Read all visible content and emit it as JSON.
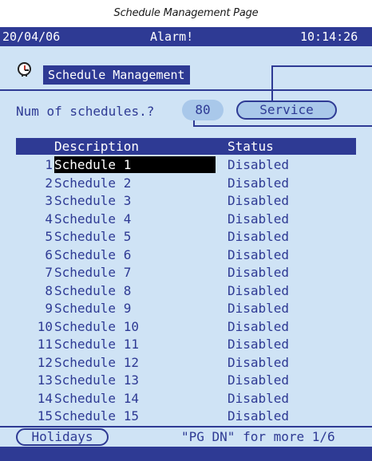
{
  "caption": "Schedule Management Page",
  "status_bar": {
    "date": "20/04/06",
    "alarm": "Alarm!",
    "time": "10:14:26"
  },
  "title": "Schedule Management",
  "num_schedules": {
    "label": "Num of schedules.?",
    "value": "80"
  },
  "service_button": "Service",
  "table": {
    "headers": {
      "description": "Description",
      "status": "Status"
    },
    "rows": [
      {
        "num": "1",
        "description": "Schedule 1",
        "status": "Disabled",
        "selected": true
      },
      {
        "num": "2",
        "description": "Schedule 2",
        "status": "Disabled"
      },
      {
        "num": "3",
        "description": "Schedule 3",
        "status": "Disabled"
      },
      {
        "num": "4",
        "description": "Schedule 4",
        "status": "Disabled"
      },
      {
        "num": "5",
        "description": "Schedule 5",
        "status": "Disabled"
      },
      {
        "num": "6",
        "description": "Schedule 6",
        "status": "Disabled"
      },
      {
        "num": "7",
        "description": "Schedule 7",
        "status": "Disabled"
      },
      {
        "num": "8",
        "description": "Schedule 8",
        "status": "Disabled"
      },
      {
        "num": "9",
        "description": "Schedule 9",
        "status": "Disabled"
      },
      {
        "num": "10",
        "description": "Schedule 10",
        "status": "Disabled"
      },
      {
        "num": "11",
        "description": "Schedule 11",
        "status": "Disabled"
      },
      {
        "num": "12",
        "description": "Schedule 12",
        "status": "Disabled"
      },
      {
        "num": "13",
        "description": "Schedule 13",
        "status": "Disabled"
      },
      {
        "num": "14",
        "description": "Schedule 14",
        "status": "Disabled"
      },
      {
        "num": "15",
        "description": "Schedule 15",
        "status": "Disabled"
      }
    ]
  },
  "footer": {
    "holidays_button": "Holidays",
    "hint": "\"PG DN\" for more 1/6"
  },
  "icons": {
    "title_icon": "alarm-clock-icon"
  },
  "colors": {
    "accent": "#2e3a94",
    "screen_bg": "#cfe3f5",
    "field_bg": "#a9c8ea"
  }
}
